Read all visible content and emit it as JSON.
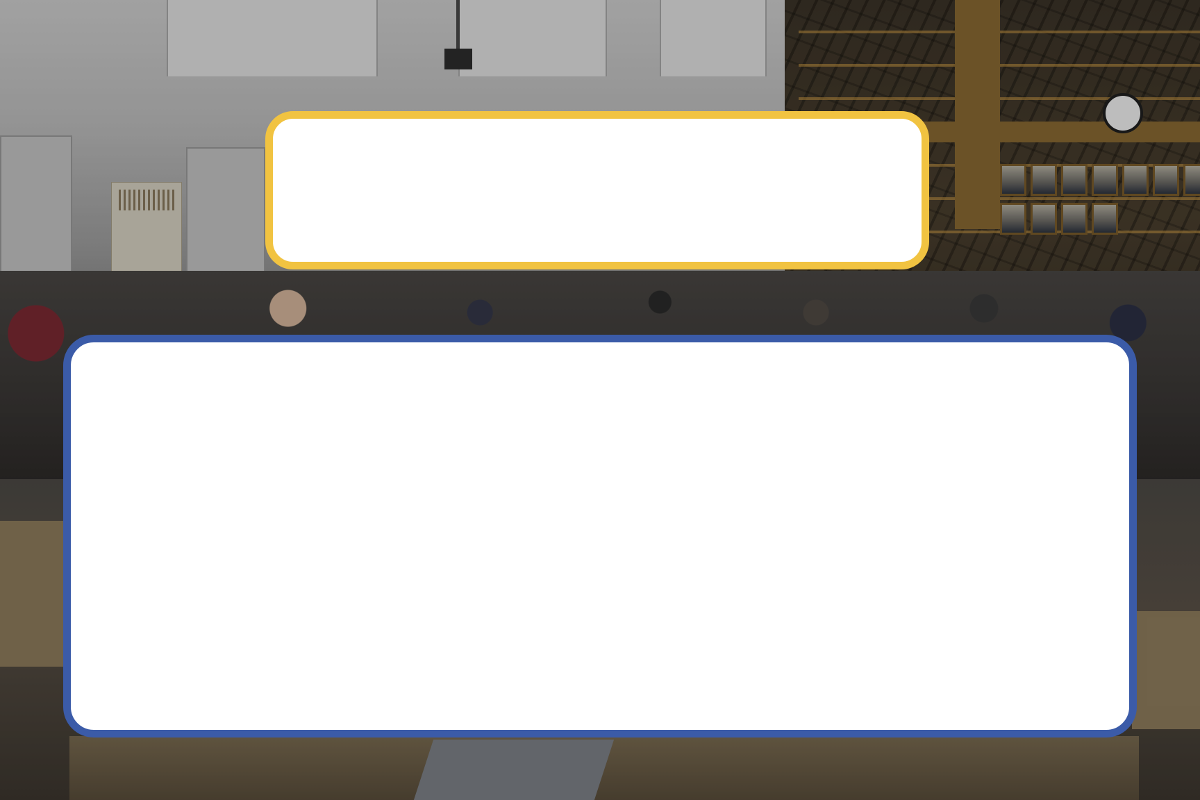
{
  "scene": {
    "background_description_colors": {
      "top_card_border": "#f1c341",
      "bottom_card_border": "#3b5ba8",
      "card_fill": "#ffffff"
    },
    "top_card": {
      "text": ""
    },
    "bottom_card": {
      "text": ""
    }
  }
}
